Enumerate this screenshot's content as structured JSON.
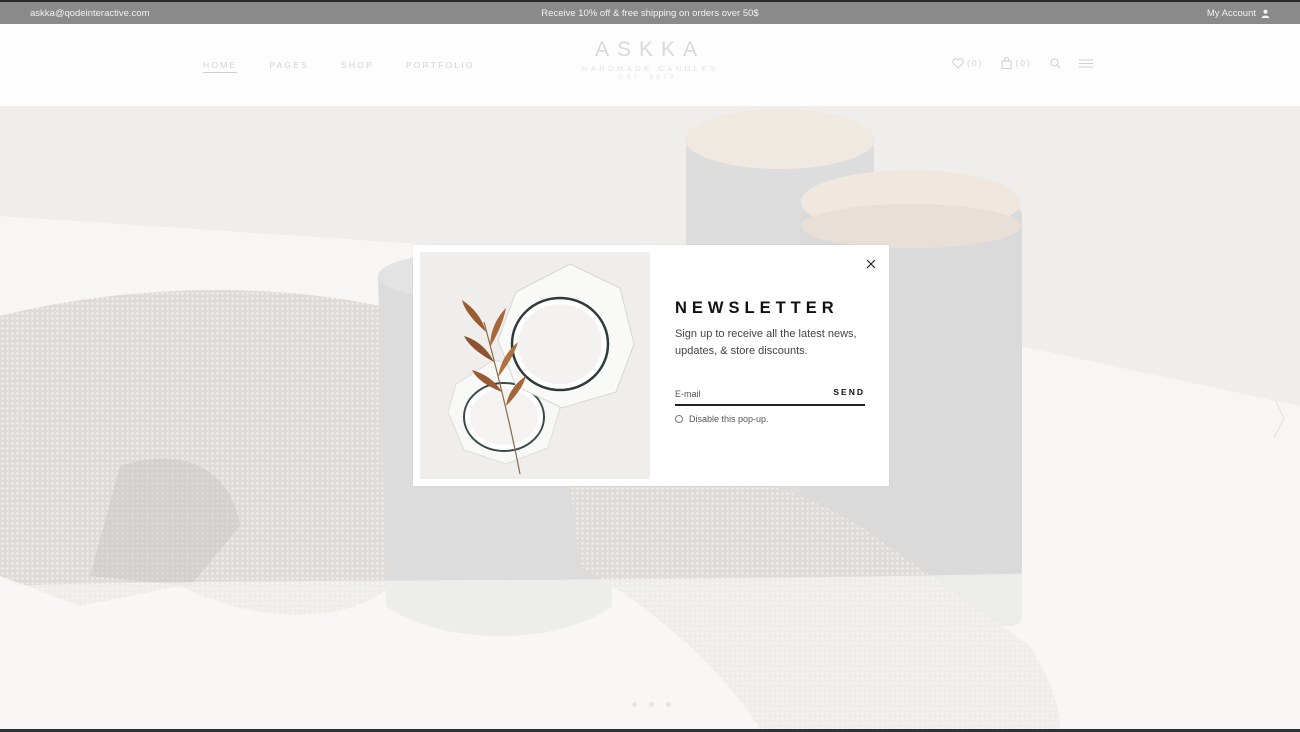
{
  "topbar": {
    "email": "askka@qodeinteractive.com",
    "promo": "Receive 10% off & free shipping on orders over 50$",
    "account": "My Account",
    "account_icon": "user-icon"
  },
  "header": {
    "nav": [
      "HOME",
      "PAGES",
      "SHOP",
      "PORTFOLIO"
    ],
    "logo": {
      "name": "ASKKA",
      "tagline": "HANDMADE CANDLES",
      "est": "EST. 1970."
    },
    "wishlist_count": "(0)",
    "cart_count": "(0)",
    "icons": [
      "heart-icon",
      "bag-icon",
      "search-icon",
      "menu-icon"
    ]
  },
  "popup": {
    "title": "NEWSLETTER",
    "description": "Sign up to receive all the latest news, updates, & store discounts.",
    "email_placeholder": "E-mail",
    "send_label": "SEND",
    "disable_label": "Disable this pop-up.",
    "close_icon": "close-icon"
  },
  "colors": {
    "overlay": "#f6f5f3",
    "text_dark": "#111111",
    "topbar": "#8a8a8a"
  }
}
